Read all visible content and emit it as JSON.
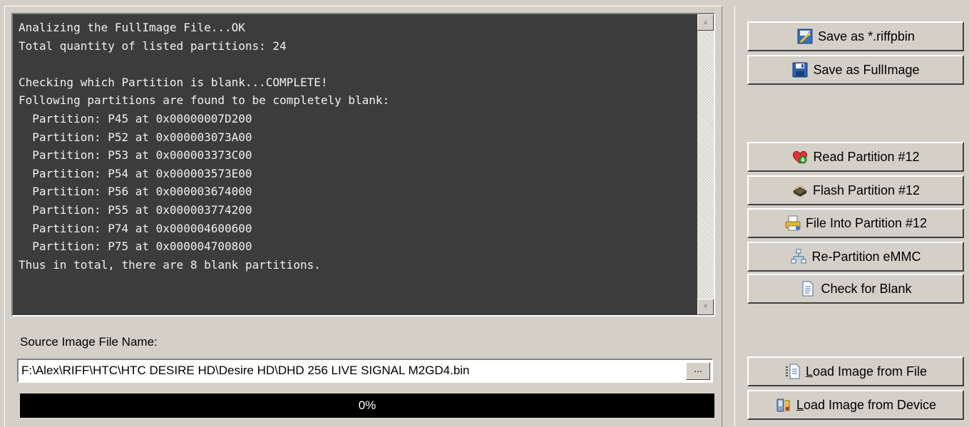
{
  "console": {
    "lines": "Analizing the FullImage File...OK\nTotal quantity of listed partitions: 24\n\nChecking which Partition is blank...COMPLETE!\nFollowing partitions are found to be completely blank:\n  Partition: P45 at 0x00000007D200\n  Partition: P52 at 0x000003073A00\n  Partition: P53 at 0x000003373C00\n  Partition: P54 at 0x000003573E00\n  Partition: P56 at 0x000003674000\n  Partition: P55 at 0x000003774200\n  Partition: P74 at 0x000004600600\n  Partition: P75 at 0x000004700800\nThus in total, there are 8 blank partitions."
  },
  "source": {
    "label": "Source Image File Name:",
    "path": "F:\\Alex\\RIFF\\HTC\\HTC DESIRE HD\\Desire HD\\DHD 256 LIVE SIGNAL M2GD4.bin",
    "browse_label": "..."
  },
  "progress": {
    "value": 0,
    "text": "0%"
  },
  "buttons": {
    "save_riffpbin": "Save as *.riffpbin",
    "save_fullimage": "Save as FullImage",
    "read_partition": "Read Partition #12",
    "flash_partition": "Flash Partition #12",
    "file_into_partition": "File Into Partition #12",
    "repartition": "Re-Partition eMMC",
    "check_blank": "Check for Blank",
    "load_file": "Load Image from File",
    "load_device": "Load Image from Device"
  },
  "icons": {
    "save_riffpbin": "tools-save-icon",
    "save_fullimage": "floppy-disk-icon",
    "read_partition": "heart-download-icon",
    "flash_partition": "chip-icon",
    "file_into_partition": "printer-file-icon",
    "repartition": "network-tree-icon",
    "check_blank": "document-icon",
    "load_file": "document-load-icon",
    "load_device": "device-load-icon"
  },
  "colors": {
    "window_bg": "#d4d0c8",
    "console_bg": "#3c3c3c",
    "console_text": "#f0f0f0",
    "progress_bg": "#000000"
  }
}
